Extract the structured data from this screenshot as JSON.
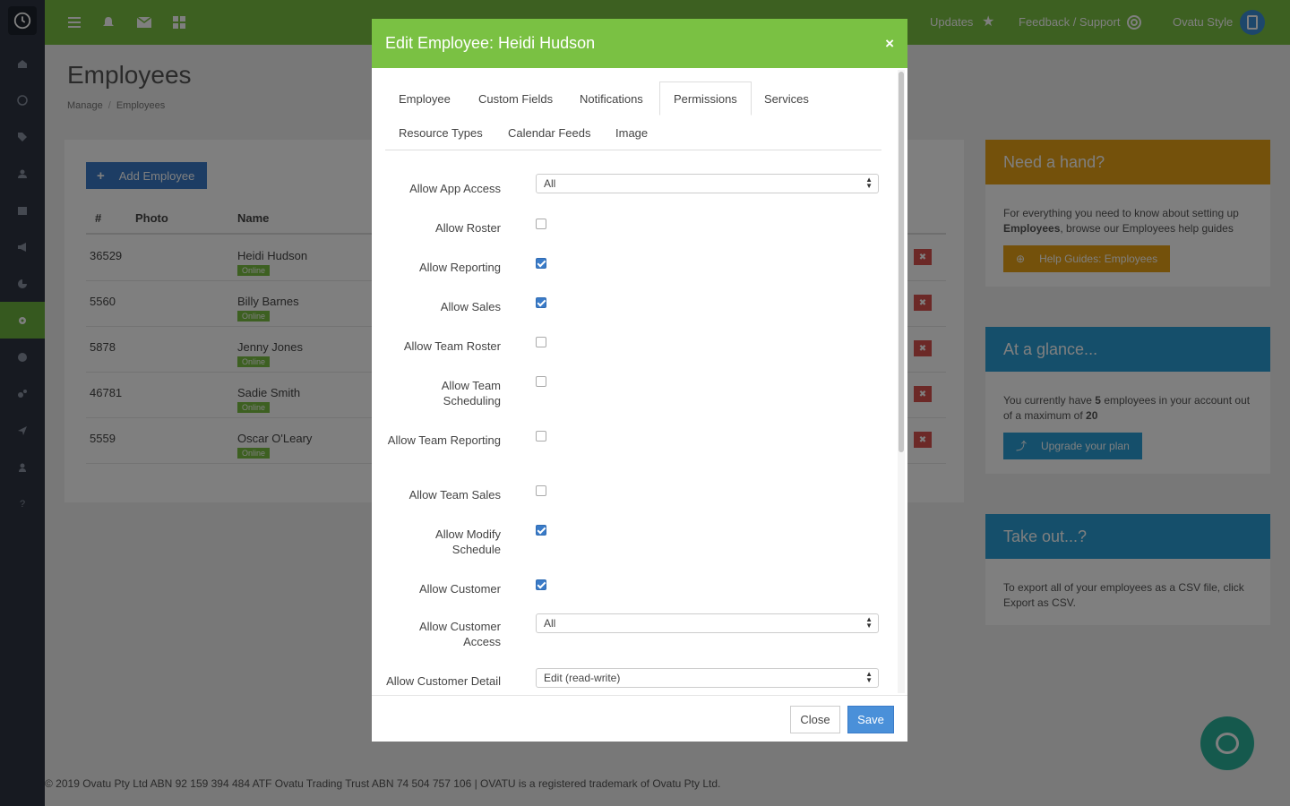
{
  "topbar": {
    "updates": "Updates",
    "feedback": "Feedback / Support",
    "user": "Ovatu Style"
  },
  "page": {
    "title": "Employees",
    "breadcrumb": [
      "Manage",
      "Employees"
    ]
  },
  "table": {
    "add_label": "Add Employee",
    "headers": [
      "#",
      "Photo",
      "Name"
    ],
    "rows": [
      {
        "id": "36529",
        "name": "Heidi Hudson",
        "badge": "Online"
      },
      {
        "id": "5560",
        "name": "Billy Barnes",
        "badge": "Online"
      },
      {
        "id": "5878",
        "name": "Jenny Jones",
        "badge": "Online"
      },
      {
        "id": "46781",
        "name": "Sadie Smith",
        "badge": "Online"
      },
      {
        "id": "5559",
        "name": "Oscar O'Leary",
        "badge": "Online"
      }
    ]
  },
  "widgets": {
    "help": {
      "title": "Need a hand?",
      "text_pre": "For everything you need to know about setting up ",
      "text_bold": "Employees",
      "text_post": ", browse our Employees help guides",
      "button": "Help Guides: Employees",
      "color": "#e8a317"
    },
    "glance": {
      "title": "At a glance...",
      "text_pre": "You currently have ",
      "count": "5",
      "text_mid": " employees in your account out of a maximum of ",
      "max": "20",
      "button": "Upgrade your plan",
      "color": "#2a9fd6"
    },
    "takeout": {
      "title": "Take out...?",
      "text": "To export all of your employees as a CSV file, click Export as CSV.",
      "color": "#2a9fd6"
    }
  },
  "footer": "© 2019 Ovatu Pty Ltd ABN 92 159 394 484 ATF Ovatu Trading Trust ABN 74 504 757 106 | OVATU is a registered trademark of Ovatu Pty Ltd.",
  "modal": {
    "title": "Edit Employee: Heidi Hudson",
    "close_symbol": "×",
    "tabs": [
      "Employee",
      "Custom Fields",
      "Notifications",
      "Permissions",
      "Services",
      "Resource Types",
      "Calendar Feeds",
      "Image"
    ],
    "active_tab": "Permissions",
    "fields": {
      "app_access": {
        "label": "Allow App Access",
        "value": "All"
      },
      "roster": {
        "label": "Allow Roster",
        "checked": false
      },
      "reporting": {
        "label": "Allow Reporting",
        "checked": true
      },
      "sales": {
        "label": "Allow Sales",
        "checked": true
      },
      "team_roster": {
        "label": "Allow Team Roster",
        "checked": false
      },
      "team_scheduling": {
        "label": "Allow Team Scheduling",
        "checked": false
      },
      "team_reporting": {
        "label": "Allow Team Reporting",
        "checked": false
      },
      "team_sales": {
        "label": "Allow Team Sales",
        "checked": false
      },
      "modify_schedule": {
        "label": "Allow Modify Schedule",
        "checked": true
      },
      "customer": {
        "label": "Allow Customer",
        "checked": true
      },
      "customer_access": {
        "label": "Allow Customer Access",
        "value": "All"
      },
      "customer_detail": {
        "label": "Allow Customer Detail",
        "value": "Edit (read-write)"
      }
    },
    "close_button": "Close",
    "save_button": "Save"
  }
}
